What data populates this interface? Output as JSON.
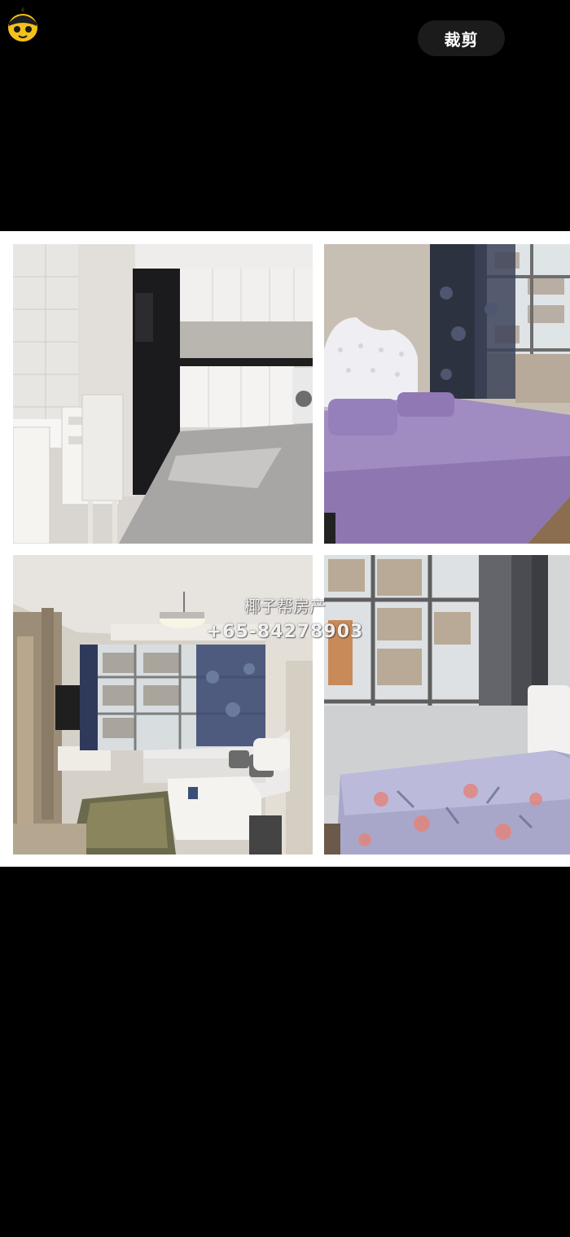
{
  "toolbar": {
    "crop_label": "裁剪",
    "logo_icon": "coconut-avatar-icon"
  },
  "collage": {
    "photos": [
      {
        "name": "kitchen-dining-photo"
      },
      {
        "name": "master-bedroom-photo"
      },
      {
        "name": "living-room-photo"
      },
      {
        "name": "second-bedroom-photo"
      }
    ]
  },
  "watermark": {
    "name": "椰子帮房产",
    "phone": "+65-84278903"
  },
  "colors": {
    "background": "#000000",
    "button_bg": "#1b1b1b",
    "collage_border": "#ffffff"
  }
}
